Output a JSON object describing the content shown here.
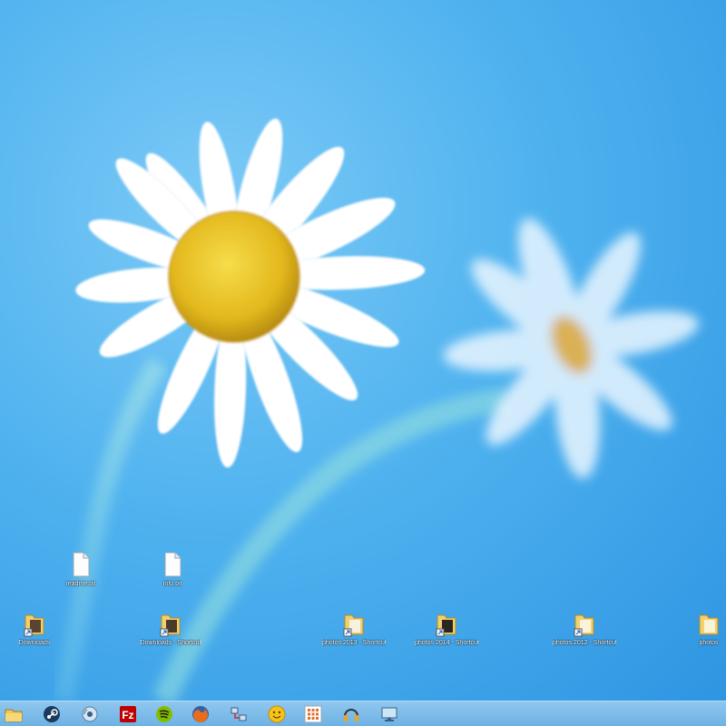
{
  "desktop": {
    "wallpaper": "daisy-flowers",
    "icons": [
      {
        "label": "readme.txt",
        "type": "file",
        "icon": "document-icon"
      },
      {
        "label": "Info.txt",
        "type": "file",
        "icon": "document-icon"
      },
      {
        "label": "Downloads",
        "type": "folder",
        "icon": "folder-shortcut-icon"
      },
      {
        "label": "Downloads - Shortcut",
        "type": "folder",
        "icon": "folder-shortcut-icon"
      },
      {
        "label": "photos 2013 - Shortcut",
        "type": "folder",
        "icon": "folder-shortcut-icon"
      },
      {
        "label": "photos 2014 - Shortcut",
        "type": "folder",
        "icon": "folder-shortcut-icon"
      },
      {
        "label": "photos 2012 - Shortcut (2)",
        "type": "folder",
        "icon": "folder-shortcut-icon"
      },
      {
        "label": "photos",
        "type": "folder",
        "icon": "folder-shortcut-icon"
      }
    ]
  },
  "taskbar": {
    "buttons": [
      {
        "name": "file-explorer",
        "icon": "folder-icon"
      },
      {
        "name": "steam",
        "icon": "steam-icon"
      },
      {
        "name": "sound-app",
        "icon": "speaker-icon"
      },
      {
        "name": "filezilla",
        "icon": "filezilla-icon"
      },
      {
        "name": "spotify",
        "icon": "spotify-icon"
      },
      {
        "name": "firefox",
        "icon": "firefox-icon"
      },
      {
        "name": "network-tool",
        "icon": "network-icon"
      },
      {
        "name": "messenger",
        "icon": "smiley-icon"
      },
      {
        "name": "apps-grid",
        "icon": "grid-icon"
      },
      {
        "name": "headphones-app",
        "icon": "headphones-icon"
      },
      {
        "name": "desktop-app",
        "icon": "monitor-icon"
      }
    ]
  },
  "colors": {
    "sky_light": "#7ccaf6",
    "sky_dark": "#2e95e2",
    "petal": "#ffffff",
    "center": "#e6c22a",
    "taskbar": "#7fbbe8"
  }
}
